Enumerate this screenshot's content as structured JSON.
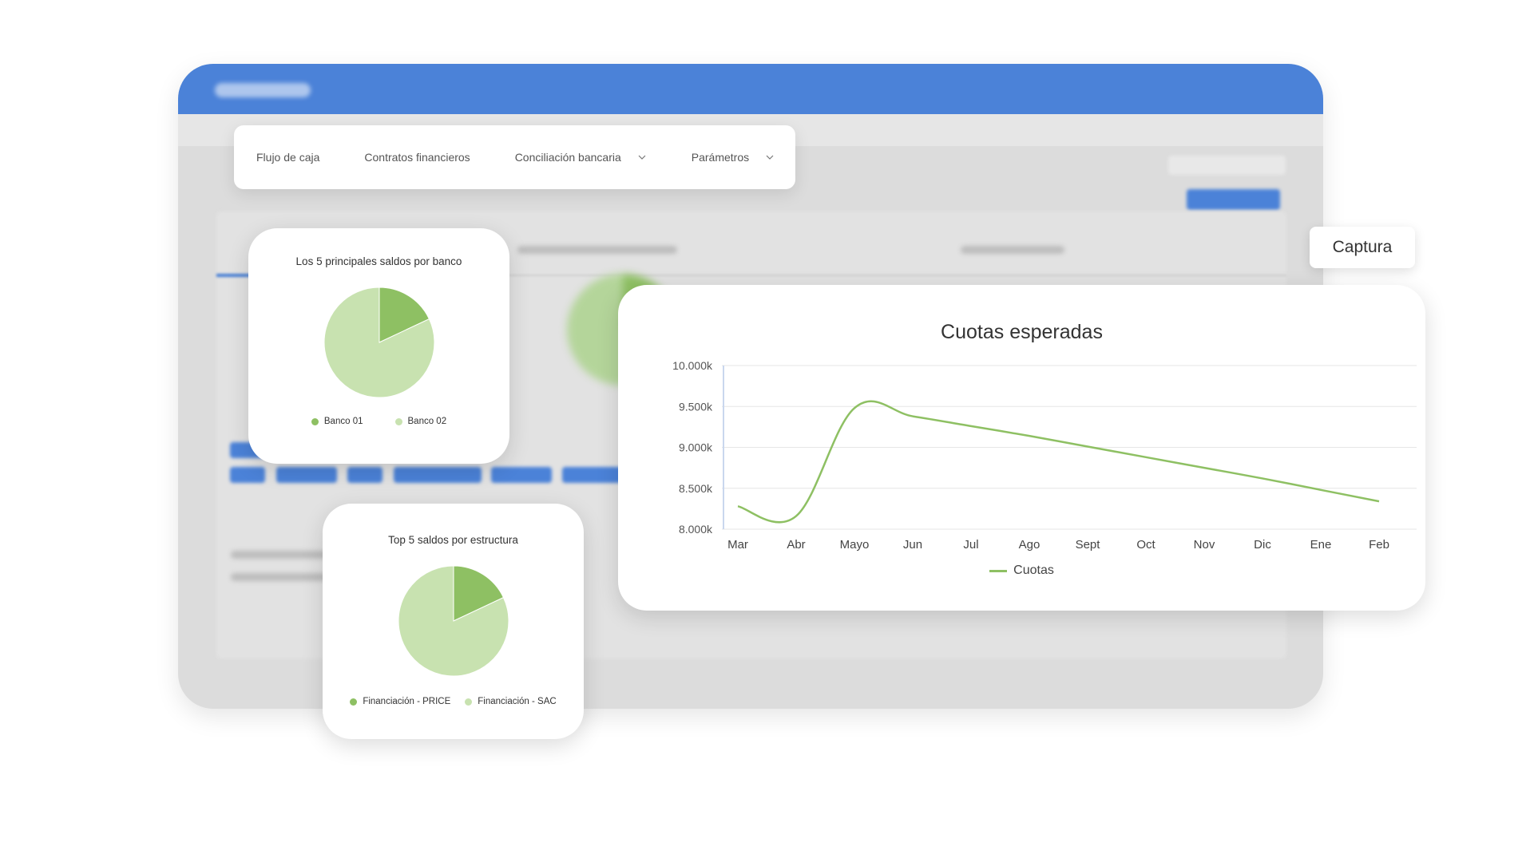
{
  "nav": {
    "items": [
      {
        "label": "Flujo de caja",
        "has_dropdown": false
      },
      {
        "label": "Contratos financieros",
        "has_dropdown": false
      },
      {
        "label": "Conciliación bancaria",
        "has_dropdown": true
      },
      {
        "label": "Parámetros",
        "has_dropdown": true
      }
    ]
  },
  "capture_button": {
    "label": "Captura"
  },
  "colors": {
    "app_header_blue": "#4b82d8",
    "series_dark_green": "#8ec063",
    "series_light_green": "#c8e2b0",
    "line_green": "#8ec063"
  },
  "chart_data": [
    {
      "type": "pie",
      "title": "Los 5 principales saldos por banco",
      "series": [
        {
          "name": "Banco 01",
          "value": 18,
          "color": "#8ec063"
        },
        {
          "name": "Banco 02",
          "value": 82,
          "color": "#c8e2b0"
        }
      ],
      "legend_position": "bottom"
    },
    {
      "type": "pie",
      "title": "Top 5 saldos por estructura",
      "series": [
        {
          "name": "Financiación - PRICE",
          "value": 18,
          "color": "#8ec063"
        },
        {
          "name": "Financiación - SAC",
          "value": 82,
          "color": "#c8e2b0"
        }
      ],
      "legend_position": "bottom"
    },
    {
      "type": "line",
      "title": "Cuotas esperadas",
      "categories": [
        "Mar",
        "Abr",
        "Mayo",
        "Jun",
        "Jul",
        "Ago",
        "Sept",
        "Oct",
        "Nov",
        "Dic",
        "Ene",
        "Feb"
      ],
      "series": [
        {
          "name": "Cuotas",
          "values": [
            8280,
            8160,
            9480,
            9380,
            9260,
            9140,
            9010,
            8880,
            8750,
            8620,
            8480,
            8340
          ],
          "color": "#8ec063"
        }
      ],
      "y_ticks": [
        "8.000k",
        "8.500k",
        "9.000k",
        "9.500k",
        "10.000k"
      ],
      "ylim": [
        8000,
        10000
      ],
      "grid": true,
      "legend_position": "bottom"
    }
  ]
}
